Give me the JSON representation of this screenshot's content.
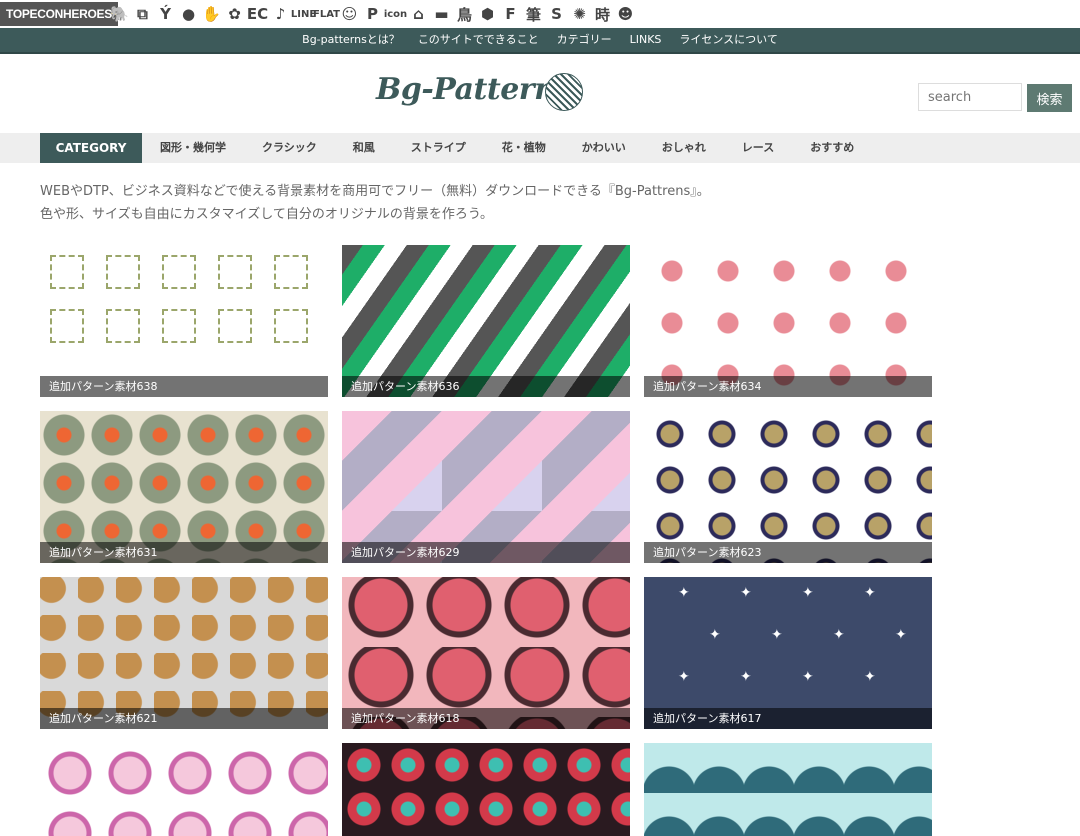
{
  "topbar": {
    "brand": "TOPECONHEROES",
    "icons": [
      "elephant-icon",
      "copy-icon",
      "figure-icon",
      "speech-icon",
      "hand-icon",
      "flower-icon",
      "EC",
      "music-icon",
      "LINE",
      "FLAT",
      "face-icon",
      "P",
      "icon",
      "house-icon",
      "sofa-icon",
      "bird-icon",
      "badge-icon",
      "F",
      "筆",
      "S",
      "grid-icon",
      "burst-icon",
      "時",
      "character-icon"
    ]
  },
  "sitenav": [
    "Bg-patternsとは？",
    "このサイトでできること",
    "カテゴリー",
    "LINKS",
    "ライセンスについて"
  ],
  "header": {
    "logo": "Bg-Patterns",
    "search_placeholder": "search",
    "search_button": "検索"
  },
  "category": {
    "head": "CATEGORY",
    "items": [
      "図形・幾何学",
      "クラシック",
      "和風",
      "ストライプ",
      "花・植物",
      "かわいい",
      "おしゃれ",
      "レース",
      "おすすめ"
    ]
  },
  "intro": {
    "line1": "WEBやDTP、ビジネス資料などで使える背景素材を商用可でフリー（無料）ダウンロードできる『Bg-Pattrens』。",
    "line2": "色や形、サイズも自由にカスタマイズして自分のオリジナルの背景を作ろう。"
  },
  "tiles": [
    {
      "caption": "追加パターン素材638"
    },
    {
      "caption": "追加パターン素材636"
    },
    {
      "caption": "追加パターン素材634"
    },
    {
      "caption": "追加パターン素材631"
    },
    {
      "caption": "追加パターン素材629"
    },
    {
      "caption": "追加パターン素材623"
    },
    {
      "caption": "追加パターン素材621"
    },
    {
      "caption": "追加パターン素材618"
    },
    {
      "caption": "追加パターン素材617"
    },
    {
      "caption": ""
    },
    {
      "caption": ""
    },
    {
      "caption": ""
    }
  ],
  "colors": {
    "primary": "#3d5a5a",
    "accent_green": "#1eae68"
  }
}
